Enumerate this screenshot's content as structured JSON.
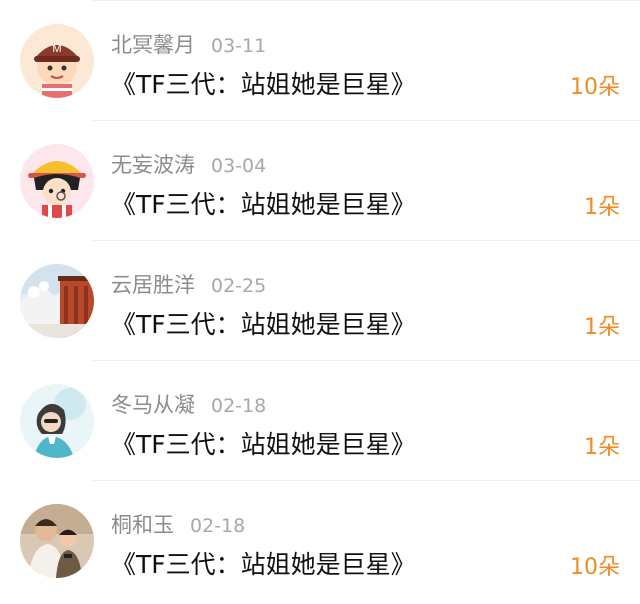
{
  "gifts": {
    "items": [
      {
        "name": "北冥馨月",
        "date": "03-11",
        "title": "《TF三代：站姐她是巨星》",
        "count": "10朵",
        "avatar_icon": "cartoon-boy-m-cap-avatar"
      },
      {
        "name": "无妄波涛",
        "date": "03-04",
        "title": "《TF三代：站姐她是巨星》",
        "count": "1朵",
        "avatar_icon": "cartoon-girl-hat-avatar"
      },
      {
        "name": "云居胜洋",
        "date": "02-25",
        "title": "《TF三代：站姐她是巨星》",
        "count": "1朵",
        "avatar_icon": "snowy-temple-avatar"
      },
      {
        "name": "冬马从凝",
        "date": "02-18",
        "title": "《TF三代：站姐她是巨星》",
        "count": "1朵",
        "avatar_icon": "girl-photo-avatar"
      },
      {
        "name": "桐和玉",
        "date": "02-18",
        "title": "《TF三代：站姐她是巨星》",
        "count": "10朵",
        "avatar_icon": "man-and-child-photo-avatar"
      }
    ]
  },
  "colors": {
    "count": "#f28b1f",
    "name": "#8c8c8c",
    "title": "#111111"
  }
}
